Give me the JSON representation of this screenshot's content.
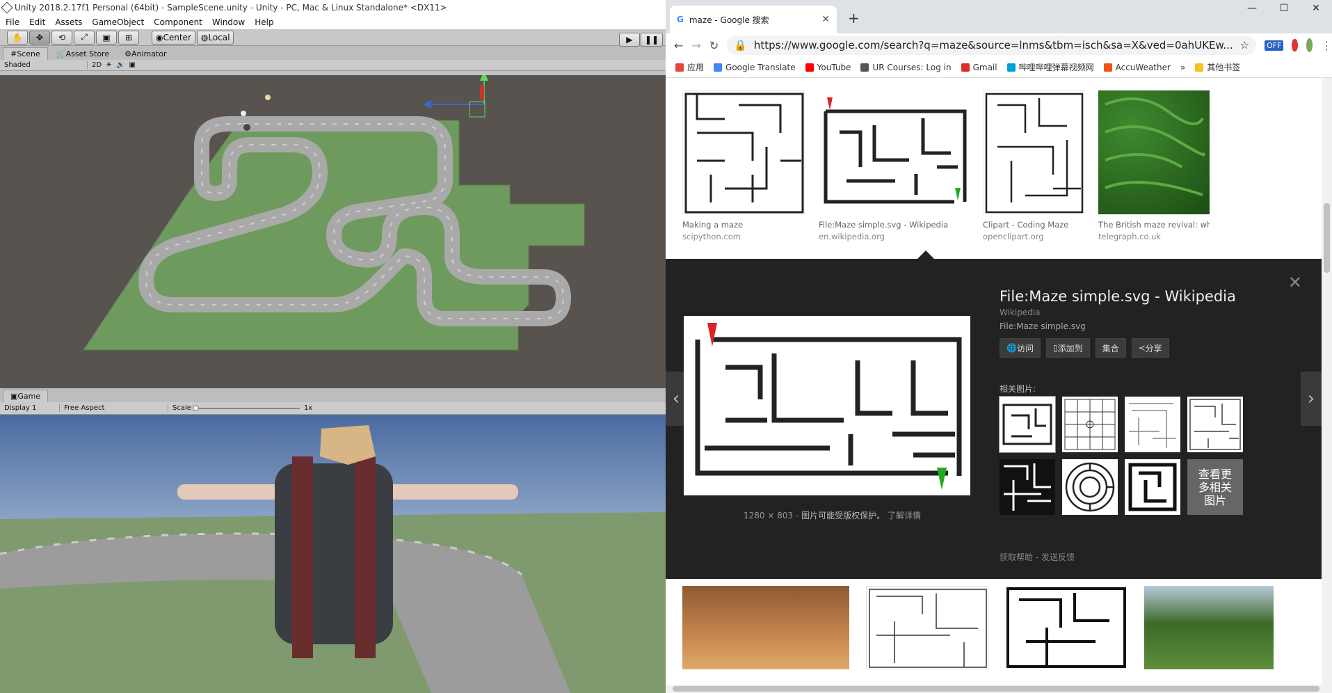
{
  "unity": {
    "title": "Unity 2018.2.17f1 Personal (64bit) - SampleScene.unity - Unity - PC, Mac & Linux Standalone* <DX11>",
    "menu": [
      "File",
      "Edit",
      "Assets",
      "GameObject",
      "Component",
      "Window",
      "Help"
    ],
    "toolbar": {
      "center": "Center",
      "local": "Local"
    },
    "tabs": [
      "Scene",
      "Asset Store",
      "Animator"
    ],
    "scene_bar": {
      "shading": "Shaded",
      "mode2d": "2D"
    },
    "game_tab": "Game",
    "game_bar": {
      "display": "Display 1",
      "aspect": "Free Aspect",
      "scale_label": "Scale",
      "scale_value": "1x"
    }
  },
  "chrome": {
    "tab_title": "maze - Google 搜索",
    "url": "https://www.google.com/search?q=maze&source=lnms&tbm=isch&sa=X&ved=0ahUKEw...",
    "bookmarks": [
      {
        "label": "应用",
        "color": "#e8453c"
      },
      {
        "label": "Google Translate",
        "color": "#4285f4"
      },
      {
        "label": "YouTube",
        "color": "#ff0000"
      },
      {
        "label": "UR Courses: Log in",
        "color": "#555555"
      },
      {
        "label": "Gmail",
        "color": "#d93025"
      },
      {
        "label": "哔哩哔哩弹幕视频网",
        "color": "#00a1d6"
      },
      {
        "label": "AccuWeather",
        "color": "#f05514"
      },
      {
        "label": "其他书签",
        "color": "#f6c026"
      }
    ],
    "results": [
      {
        "title": "Making a maze",
        "domain": "scipython.com"
      },
      {
        "title": "File:Maze simple.svg - Wikipedia",
        "domain": "en.wikipedia.org"
      },
      {
        "title": "Clipart - Coding Maze",
        "domain": "openclipart.org"
      },
      {
        "title": "The British maze revival: why g...",
        "domain": "telegraph.co.uk"
      }
    ],
    "panel": {
      "title": "File:Maze simple.svg - Wikipedia",
      "site": "Wikipedia",
      "file": "File:Maze simple.svg",
      "buttons": [
        "访问",
        "添加到",
        "集合",
        "分享"
      ],
      "dims": "1280 × 803",
      "copyright": "图片可能受版权保护。",
      "learn": "了解详情",
      "related_label": "相关图片:",
      "more_label": "查看更多相关图片",
      "help": "获取帮助",
      "feedback": "发送反馈"
    }
  }
}
